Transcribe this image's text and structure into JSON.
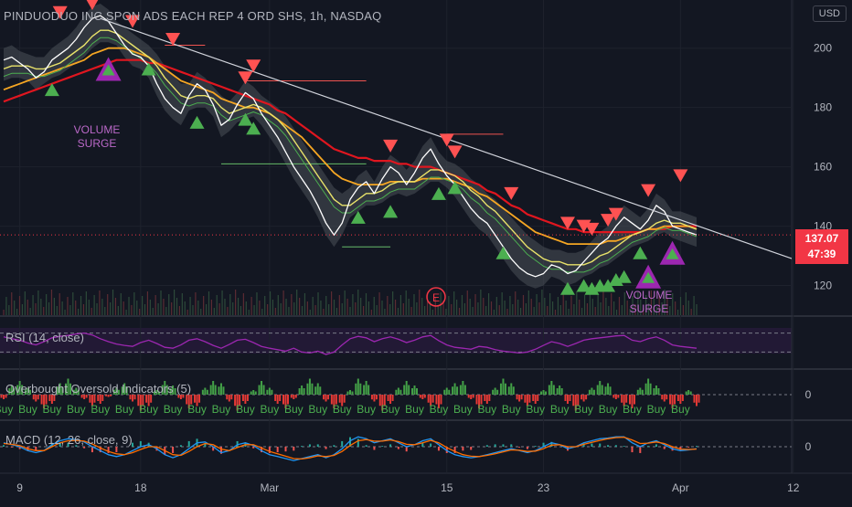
{
  "header": {
    "title": "PINDUODUO INC SPON ADS EACH REP 4 ORD SHS, 1h, NASDAQ",
    "currency": "USD"
  },
  "price_tag": {
    "price": "137.07",
    "countdown": "47:39"
  },
  "annotations": {
    "volume_surge_1": [
      "VOLUME",
      "SURGE"
    ],
    "volume_surge_2": [
      "VOLUME",
      "SURGE"
    ],
    "earnings": "E"
  },
  "colors": {
    "background": "#131722",
    "red_ma": "#e0161f",
    "orange_ma": "#f5a623",
    "yellow_ma": "#e8e26a",
    "green_band": "#4caf50",
    "rsi_line": "#9c27b0",
    "sell_marker": "#ff5252",
    "buy_marker": "#4caf50",
    "surge_marker": "#9c27b0",
    "trendline": "#d1d4dc",
    "price_label": "#f23645"
  },
  "chart_data": [
    {
      "type": "line",
      "pane": "price",
      "title": "PINDUODUO INC SPON ADS EACH REP 4 ORD SHS, 1h, NASDAQ",
      "x_ticks": [
        "9",
        "18",
        "Mar",
        "15",
        "23",
        "Apr",
        "12"
      ],
      "y_ticks": [
        120,
        140,
        160,
        180,
        200
      ],
      "ylim": [
        110,
        215
      ],
      "last_price": 137.07,
      "series": [
        {
          "key": "price",
          "color": "#ffffff",
          "values": [
            196,
            197,
            195,
            193,
            190,
            192,
            196,
            198,
            200,
            203,
            207,
            210,
            211,
            209,
            205,
            201,
            198,
            197,
            194,
            188,
            183,
            180,
            178,
            184,
            188,
            186,
            181,
            174,
            176,
            181,
            185,
            183,
            178,
            174,
            170,
            165,
            160,
            156,
            152,
            147,
            141,
            137,
            141,
            149,
            153,
            155,
            151,
            156,
            160,
            158,
            154,
            158,
            163,
            166,
            161,
            157,
            154,
            150,
            146,
            143,
            141,
            137,
            133,
            129,
            126,
            124,
            123,
            124,
            127,
            126,
            124,
            125,
            128,
            131,
            134,
            136,
            140,
            143,
            141,
            139,
            142,
            147,
            145,
            140,
            139,
            138,
            137.07
          ]
        },
        {
          "key": "ma_fast",
          "color": "#e8e26a",
          "values": [
            193,
            194,
            194,
            194,
            193,
            193,
            194,
            195,
            197,
            199,
            201,
            204,
            206,
            206,
            205,
            203,
            201,
            199,
            197,
            194,
            190,
            187,
            184,
            183,
            184,
            184,
            183,
            180,
            178,
            179,
            180,
            181,
            180,
            178,
            176,
            173,
            169,
            165,
            161,
            157,
            153,
            149,
            147,
            147,
            149,
            151,
            151,
            152,
            154,
            155,
            155,
            155,
            157,
            159,
            159,
            158,
            157,
            155,
            152,
            150,
            147,
            145,
            142,
            139,
            136,
            133,
            131,
            129,
            128,
            128,
            127,
            127,
            127,
            128,
            130,
            131,
            133,
            135,
            137,
            138,
            139,
            141,
            142,
            141,
            141,
            140,
            139
          ]
        },
        {
          "key": "ma_mid",
          "color": "#f5a623",
          "values": [
            186,
            187,
            188,
            189,
            190,
            191,
            192,
            193,
            194,
            195,
            196,
            198,
            199,
            200,
            200,
            200,
            199,
            198,
            197,
            195,
            193,
            191,
            189,
            188,
            187,
            186,
            185,
            183,
            182,
            181,
            180,
            180,
            179,
            178,
            176,
            174,
            172,
            170,
            167,
            164,
            161,
            158,
            156,
            155,
            154,
            154,
            154,
            154,
            155,
            155,
            155,
            155,
            156,
            156,
            156,
            156,
            155,
            154,
            153,
            151,
            150,
            148,
            146,
            144,
            142,
            140,
            138,
            137,
            136,
            135,
            134,
            134,
            134,
            134,
            134,
            135,
            135,
            136,
            137,
            138,
            139,
            139,
            140,
            140,
            140,
            140,
            139
          ]
        },
        {
          "key": "ma_slow",
          "color": "#e0161f",
          "values": [
            182,
            183,
            184,
            185,
            186,
            187,
            188,
            189,
            190,
            191,
            192,
            193,
            194,
            195,
            196,
            196,
            196,
            196,
            195,
            195,
            194,
            193,
            192,
            191,
            190,
            189,
            188,
            187,
            186,
            185,
            184,
            183,
            182,
            181,
            179,
            178,
            176,
            174,
            172,
            170,
            168,
            166,
            165,
            164,
            163,
            163,
            162,
            162,
            162,
            161,
            161,
            160,
            160,
            160,
            159,
            158,
            157,
            156,
            155,
            154,
            152,
            151,
            149,
            147,
            146,
            144,
            143,
            142,
            141,
            140,
            139,
            139,
            138,
            138,
            138,
            138,
            138,
            138,
            138,
            138,
            139,
            139,
            139,
            140,
            140,
            140,
            140
          ]
        }
      ],
      "sell_signals": [
        {
          "x": 7,
          "y": 212
        },
        {
          "x": 11,
          "y": 215
        },
        {
          "x": 16,
          "y": 209
        },
        {
          "x": 21,
          "y": 203
        },
        {
          "x": 31,
          "y": 194
        },
        {
          "x": 30,
          "y": 190
        },
        {
          "x": 48,
          "y": 167
        },
        {
          "x": 55,
          "y": 169
        },
        {
          "x": 56,
          "y": 165
        },
        {
          "x": 63,
          "y": 151
        },
        {
          "x": 70,
          "y": 141
        },
        {
          "x": 72,
          "y": 140
        },
        {
          "x": 73,
          "y": 139
        },
        {
          "x": 75,
          "y": 142
        },
        {
          "x": 76,
          "y": 144
        },
        {
          "x": 80,
          "y": 152
        },
        {
          "x": 84,
          "y": 157
        }
      ],
      "buy_signals": [
        {
          "x": 6,
          "y": 186
        },
        {
          "x": 18,
          "y": 193
        },
        {
          "x": 24,
          "y": 175
        },
        {
          "x": 31,
          "y": 173
        },
        {
          "x": 30,
          "y": 176
        },
        {
          "x": 44,
          "y": 143
        },
        {
          "x": 48,
          "y": 145
        },
        {
          "x": 54,
          "y": 151
        },
        {
          "x": 56,
          "y": 153
        },
        {
          "x": 62,
          "y": 131
        },
        {
          "x": 70,
          "y": 119
        },
        {
          "x": 72,
          "y": 120
        },
        {
          "x": 73,
          "y": 119
        },
        {
          "x": 74,
          "y": 120
        },
        {
          "x": 75,
          "y": 120
        },
        {
          "x": 76,
          "y": 122
        },
        {
          "x": 77,
          "y": 123
        },
        {
          "x": 79,
          "y": 131
        }
      ],
      "volume_surge_markers": [
        {
          "x": 13,
          "y": 193
        },
        {
          "x": 80,
          "y": 123
        },
        {
          "x": 83,
          "y": 131
        }
      ],
      "trendline": {
        "from": {
          "x": 12,
          "y": 210
        },
        "to": {
          "x": 100,
          "y": 127
        }
      },
      "resistance_levels": [
        {
          "x0": 20,
          "x1": 25,
          "y": 201
        },
        {
          "x0": 30,
          "x1": 45,
          "y": 189
        },
        {
          "x0": 55,
          "x1": 62,
          "y": 171
        },
        {
          "x0": 27,
          "x1": 45,
          "y": 161
        },
        {
          "x0": 42,
          "x1": 48,
          "y": 133
        }
      ]
    },
    {
      "type": "line",
      "pane": "rsi",
      "title": "RSI (14, close)",
      "ylim": [
        0,
        100
      ],
      "upper_band": 70,
      "lower_band": 30,
      "color": "#9c27b0",
      "values": [
        62,
        58,
        55,
        49,
        45,
        52,
        60,
        63,
        65,
        68,
        70,
        66,
        58,
        52,
        47,
        44,
        42,
        50,
        55,
        48,
        40,
        38,
        45,
        55,
        58,
        52,
        44,
        38,
        46,
        55,
        57,
        50,
        42,
        38,
        35,
        32,
        38,
        30,
        28,
        32,
        25,
        30,
        45,
        58,
        63,
        60,
        52,
        58,
        62,
        57,
        50,
        55,
        62,
        65,
        54,
        45,
        40,
        38,
        36,
        42,
        40,
        35,
        32,
        30,
        28,
        30,
        36,
        44,
        52,
        48,
        42,
        48,
        55,
        58,
        60,
        62,
        64,
        65,
        55,
        52,
        58,
        62,
        55,
        45,
        42,
        40,
        38
      ]
    },
    {
      "type": "bar",
      "pane": "oscillator",
      "title": "Overbought Oversold Indicators (5)",
      "ylim": [
        -10,
        10
      ],
      "y_ticks": [
        0
      ],
      "signal_label": "Buy",
      "values": [
        -2,
        4,
        6,
        3,
        -3,
        -6,
        -4,
        5,
        7,
        3,
        -2,
        -5,
        -4,
        -1,
        3,
        5,
        -3,
        -7,
        -5,
        2,
        6,
        4,
        -2,
        -6,
        -5,
        3,
        6,
        5,
        -3,
        -7,
        -4,
        2,
        6,
        3,
        -4,
        -6,
        -2,
        4,
        7,
        5,
        -3,
        -6,
        -5,
        2,
        7,
        6,
        -3,
        -7,
        -4,
        3,
        6,
        4,
        -2,
        -5,
        -6,
        3,
        5,
        6,
        -2,
        -6,
        -4,
        3,
        7,
        5,
        -3,
        -5,
        -4,
        2,
        6,
        4,
        -4,
        -7,
        -3,
        3,
        6,
        5,
        -2,
        -5,
        -6,
        3,
        7,
        4,
        -3,
        -6,
        -4,
        2,
        -5
      ]
    },
    {
      "type": "line",
      "pane": "macd",
      "title": "MACD (12, 26, close, 9)",
      "ylim": [
        -6,
        6
      ],
      "y_ticks": [
        0
      ],
      "series": [
        {
          "key": "macd",
          "color": "#2196f3",
          "values": [
            1,
            0.5,
            0,
            -1,
            -1.5,
            -1,
            0.5,
            1.5,
            2,
            1.8,
            1.2,
            0,
            -1,
            -2,
            -2.5,
            -2,
            -1,
            0,
            0.5,
            -0.5,
            -2,
            -2.8,
            -2,
            -0.5,
            1,
            1.2,
            0,
            -1.5,
            -1,
            0.5,
            1,
            0.3,
            -1,
            -2,
            -2.5,
            -3,
            -3.5,
            -3,
            -2.5,
            -2,
            -2.8,
            -2,
            -0.5,
            1.5,
            2.5,
            2,
            1,
            1.5,
            2,
            1,
            0,
            0.5,
            1.5,
            2,
            0.5,
            -1,
            -2,
            -2.5,
            -2.8,
            -2.5,
            -2,
            -1.5,
            -1,
            -0.5,
            -1,
            -1.5,
            -1,
            0,
            1,
            0.5,
            -0.5,
            0,
            1,
            1.5,
            2,
            2.2,
            2.5,
            2.5,
            1,
            0,
            1,
            1.5,
            0.5,
            -0.5,
            -1,
            -0.8,
            -0.5
          ]
        },
        {
          "key": "signal",
          "color": "#ff6d00",
          "values": [
            0.8,
            0.6,
            0.3,
            -0.5,
            -1,
            -1,
            0,
            1,
            1.5,
            1.6,
            1.4,
            0.7,
            -0.3,
            -1.2,
            -1.8,
            -2,
            -1.5,
            -0.7,
            0,
            0,
            -1,
            -2,
            -2.2,
            -1.2,
            0,
            0.8,
            0.5,
            -0.6,
            -1,
            -0.2,
            0.5,
            0.5,
            -0.3,
            -1.2,
            -1.8,
            -2.4,
            -3,
            -3.1,
            -2.8,
            -2.3,
            -2.5,
            -2.2,
            -1.2,
            0.3,
            1.5,
            1.8,
            1.4,
            1.4,
            1.7,
            1.3,
            0.6,
            0.5,
            1,
            1.6,
            1,
            -0.2,
            -1.2,
            -2,
            -2.4,
            -2.5,
            -2.2,
            -1.8,
            -1.3,
            -0.8,
            -0.9,
            -1.2,
            -1.1,
            -0.5,
            0.4,
            0.5,
            0,
            0,
            0.6,
            1.1,
            1.6,
            2,
            2.3,
            2.4,
            1.7,
            0.8,
            0.9,
            1.2,
            0.8,
            0,
            -0.6,
            -0.7,
            -0.6
          ]
        }
      ]
    }
  ]
}
